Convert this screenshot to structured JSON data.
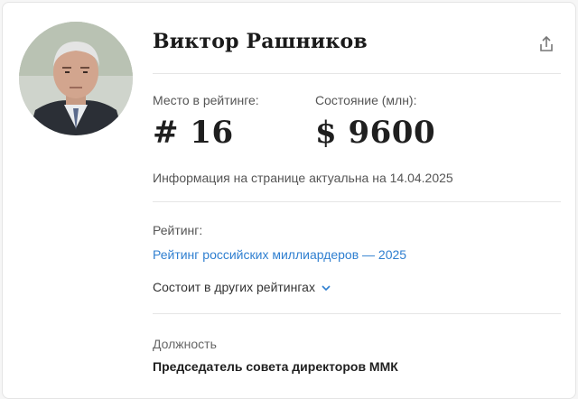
{
  "person": {
    "name": "Виктор Рашников"
  },
  "stats": {
    "rank_label": "Место в рейтинге:",
    "rank_value": "# 16",
    "wealth_label": "Состояние (млн):",
    "wealth_value": "$ 9600"
  },
  "info_text": "Информация на странице актуальна на 14.04.2025",
  "rating": {
    "label": "Рейтинг:",
    "link": "Рейтинг российских миллиардеров — 2025",
    "other_label": "Состоит в других рейтингах"
  },
  "position": {
    "label": "Должность",
    "value": "Председатель совета директоров ММК"
  },
  "colors": {
    "link": "#2f7fd0",
    "divider": "#e6e6e6"
  },
  "icons": {
    "share": "share-icon",
    "chevron": "chevron-down-icon"
  }
}
